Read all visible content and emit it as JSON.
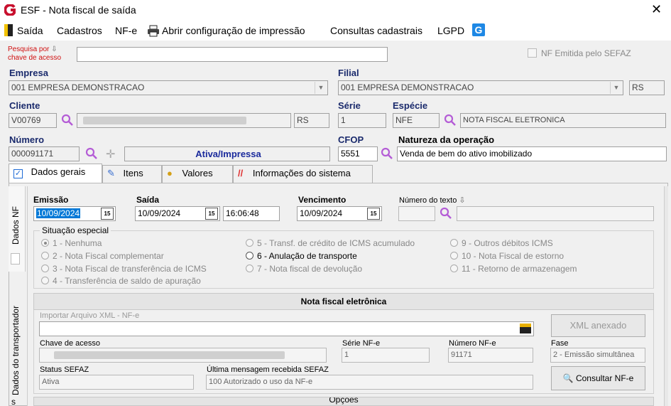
{
  "window": {
    "title": "ESF - Nota fiscal de saída"
  },
  "menu": {
    "exit": "Saída",
    "registrations": "Cadastros",
    "nfe": "NF-e",
    "print_config": "Abrir configuração de impressão",
    "queries": "Consultas cadastrais",
    "lgpd": "LGPD"
  },
  "search": {
    "label_line1": "Pesquisa por",
    "label_line2": "chave de acesso",
    "value": ""
  },
  "sefaz_checkbox": {
    "label": "NF Emitida pelo SEFAZ",
    "checked": false
  },
  "empresa": {
    "label": "Empresa",
    "value": "001 EMPRESA DEMONSTRACAO"
  },
  "filial": {
    "label": "Filial",
    "value": "001 EMPRESA DEMONSTRACAO",
    "uf": "RS"
  },
  "cliente": {
    "label": "Cliente",
    "code": "V00769",
    "uf": "RS"
  },
  "serie": {
    "label": "Série",
    "value": "1"
  },
  "especie": {
    "label": "Espécie",
    "code": "NFE",
    "description": "NOTA FISCAL ELETRONICA"
  },
  "numero": {
    "label": "Número",
    "value": "000091171",
    "status": "Ativa/Impressa"
  },
  "cfop": {
    "label": "CFOP",
    "value": "5551"
  },
  "natureza": {
    "label": "Natureza da operação",
    "value": "Venda de bem do ativo imobilizado"
  },
  "tabs": [
    "Dados gerais",
    "Itens",
    "Valores",
    "Informações do sistema"
  ],
  "side_tabs": [
    "Dados NF",
    "Dados do transportador"
  ],
  "side_tab_partial": "s",
  "dates": {
    "emissao_label": "Emissão",
    "emissao": "10/09/2024",
    "saida_label": "Saída",
    "saida": "10/09/2024",
    "saida_hora": "16:06:48",
    "vencimento_label": "Vencimento",
    "vencimento": "10/09/2024",
    "numero_texto_label": "Número do texto",
    "cal_icon": "15"
  },
  "situacao": {
    "label": "Situação especial",
    "options": [
      "1 - Nenhuma",
      "2 - Nota Fiscal complementar",
      "3 - Nota Fiscal de transferência de ICMS",
      "4 - Transferência de saldo de apuração",
      "5 - Transf. de crédito de ICMS acumulado",
      "6 - Anulação de transporte",
      "7 - Nota fiscal de devolução",
      "9 - Outros débitos ICMS",
      "10 - Nota Fiscal de estorno",
      "11 - Retorno de armazenagem"
    ],
    "selected": "1 - Nenhuma"
  },
  "nfe_section": {
    "title": "Nota fiscal eletrônica",
    "import_label": "Importar Arquivo XML - NF-e",
    "import_value": "",
    "xml_button": "XML anexado",
    "chave_label": "Chave de acesso",
    "serie_label": "Série NF-e",
    "serie_value": "1",
    "numero_label": "Número NF-e",
    "numero_value": "91171",
    "fase_label": "Fase",
    "fase_value": "2 - Emissão simultânea",
    "status_label": "Status SEFAZ",
    "status_value": "Ativa",
    "mensagem_label": "Última mensagem recebida SEFAZ",
    "mensagem_value": "100 Autorizado o uso da NF-e",
    "consultar_button": "Consultar NF-e"
  },
  "options_section": {
    "title": "Opções"
  },
  "colors": {
    "label_blue": "#1a2a6c",
    "logo_red": "#c8102e",
    "magnify": "#b45cd6",
    "status_blue": "#1a2a9c"
  }
}
